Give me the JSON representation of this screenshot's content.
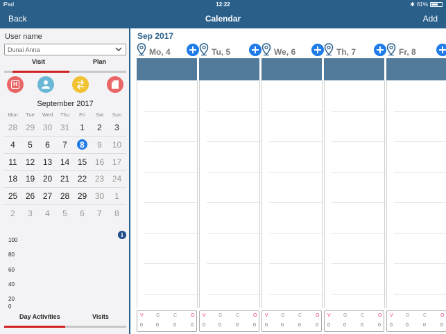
{
  "status": {
    "device": "iPad",
    "time": "12:22",
    "battery": "61%"
  },
  "nav": {
    "back": "Back",
    "title": "Calendar",
    "add": "Add"
  },
  "sidebar": {
    "user_label": "User name",
    "user_value": "Dunai Anna",
    "segments": {
      "visit": "Visit",
      "plan": "Plan"
    },
    "month_title": "September 2017",
    "weekdays": [
      "Mon",
      "Tue",
      "Wed",
      "Thu",
      "Fri",
      "Sat",
      "Sun"
    ],
    "weeks": [
      [
        "28",
        "29",
        "30",
        "31",
        "1",
        "2",
        "3"
      ],
      [
        "4",
        "5",
        "6",
        "7",
        "8",
        "9",
        "10"
      ],
      [
        "11",
        "12",
        "13",
        "14",
        "15",
        "16",
        "17"
      ],
      [
        "18",
        "19",
        "20",
        "21",
        "22",
        "23",
        "24"
      ],
      [
        "25",
        "26",
        "27",
        "28",
        "29",
        "30",
        "1"
      ],
      [
        "2",
        "3",
        "4",
        "5",
        "6",
        "7",
        "8"
      ]
    ],
    "selected_date": "8",
    "chart_ticks": [
      "100",
      "80",
      "60",
      "40",
      "20",
      "0"
    ],
    "tabs": {
      "day_activities": "Day Activities",
      "visits": "Visits"
    }
  },
  "calendar": {
    "month_label": "Sep 2017",
    "days": [
      {
        "label": "Mo, 4"
      },
      {
        "label": "Tu, 5"
      },
      {
        "label": "We, 6"
      },
      {
        "label": "Th, 7"
      },
      {
        "label": "Fr, 8"
      }
    ],
    "counters": {
      "letters": [
        "V",
        "G",
        "C",
        "O"
      ],
      "values": [
        "0",
        "0",
        "0",
        "0"
      ]
    }
  },
  "colors": {
    "accent": "#2a5f8a",
    "selection": "#1e7be8",
    "active_tab": "#d32121"
  }
}
